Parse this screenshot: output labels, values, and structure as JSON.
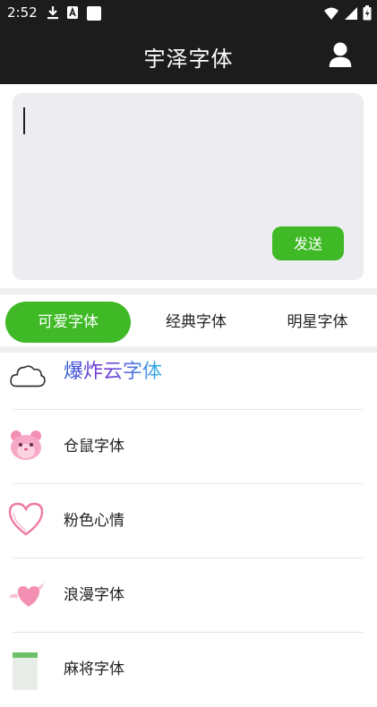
{
  "status_bar": {
    "time": "2:52",
    "left_icons": [
      "download-icon",
      "a-box-icon",
      "square-icon"
    ],
    "right_icons": [
      "wifi-icon",
      "signal-icon",
      "battery-icon"
    ]
  },
  "app_bar": {
    "title": "宇泽字体",
    "profile_icon": "person-icon"
  },
  "editor": {
    "text": "",
    "send_label": "发送"
  },
  "tabs": [
    {
      "label": "可爱字体",
      "active": true
    },
    {
      "label": "经典字体",
      "active": false
    },
    {
      "label": "明星字体",
      "active": false
    }
  ],
  "font_list": [
    {
      "label": "爆炸云字体",
      "icon": "cloud-icon"
    },
    {
      "label": "仓鼠字体",
      "icon": "hamster-icon"
    },
    {
      "label": "粉色心情",
      "icon": "pink-heart-icon"
    },
    {
      "label": "浪漫字体",
      "icon": "winged-heart-icon"
    },
    {
      "label": "麻将字体",
      "icon": "mahjong-tile-icon"
    }
  ],
  "colors": {
    "accent": "#3fba26",
    "app_bar": "#1c1c1c",
    "editor_bg": "#ececf1"
  }
}
